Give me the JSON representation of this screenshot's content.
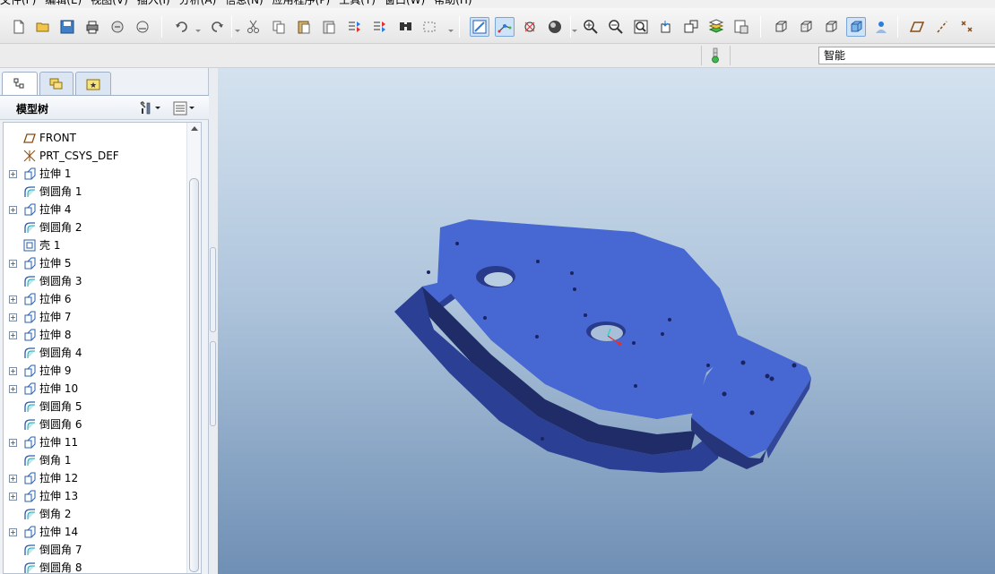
{
  "menubar": {
    "items": [
      "文件(F)",
      "编辑(E)",
      "视图(V)",
      "插入(I)",
      "分析(A)",
      "信息(N)",
      "应用程序(P)",
      "工具(T)",
      "窗口(W)",
      "帮助(H)"
    ]
  },
  "toolbar": {
    "icons": [
      "new-file-icon",
      "open-folder-icon",
      "save-icon",
      "print-icon",
      "send-mail-icon",
      "email-attach-icon",
      "undo-icon",
      "redo-icon",
      "cut-icon",
      "copy-icon",
      "paste-icon",
      "paste-special-icon",
      "regenerate-icon",
      "regenerate-manager-icon",
      "find-icon",
      "select-box-icon",
      "repaint-icon",
      "spin-center-icon",
      "orient-mode-icon",
      "shading-icon",
      "zoom-in-icon",
      "zoom-out-icon",
      "refit-icon",
      "reorient-icon",
      "saved-views-icon",
      "layers-icon",
      "view-manager-icon",
      "wireframe-icon",
      "hidden-line-icon",
      "no-hidden-icon",
      "shaded-icon",
      "enhanced-realism-icon",
      "datum-planes-icon",
      "datum-axes-icon",
      "datum-points-icon"
    ]
  },
  "strip": {
    "filter_value": "智能"
  },
  "model_tree": {
    "title": "模型树",
    "tabs": [
      "model-tree-tab",
      "layer-tab",
      "favorites-tab"
    ],
    "items": [
      {
        "label": "FRONT",
        "type": "datum-plane",
        "expandable": false
      },
      {
        "label": "PRT_CSYS_DEF",
        "type": "csys",
        "expandable": false
      },
      {
        "label": "拉伸 1",
        "type": "extrude",
        "expandable": true
      },
      {
        "label": "倒圆角 1",
        "type": "round",
        "expandable": false
      },
      {
        "label": "拉伸 4",
        "type": "extrude",
        "expandable": true
      },
      {
        "label": "倒圆角 2",
        "type": "round",
        "expandable": false
      },
      {
        "label": "壳 1",
        "type": "shell",
        "expandable": false
      },
      {
        "label": "拉伸 5",
        "type": "extrude",
        "expandable": true
      },
      {
        "label": "倒圆角 3",
        "type": "round",
        "expandable": false
      },
      {
        "label": "拉伸 6",
        "type": "extrude",
        "expandable": true
      },
      {
        "label": "拉伸 7",
        "type": "extrude",
        "expandable": true
      },
      {
        "label": "拉伸 8",
        "type": "extrude",
        "expandable": true
      },
      {
        "label": "倒圆角 4",
        "type": "round",
        "expandable": false
      },
      {
        "label": "拉伸 9",
        "type": "extrude",
        "expandable": true
      },
      {
        "label": "拉伸 10",
        "type": "extrude",
        "expandable": true
      },
      {
        "label": "倒圆角 5",
        "type": "round",
        "expandable": false
      },
      {
        "label": "倒圆角 6",
        "type": "round",
        "expandable": false
      },
      {
        "label": "拉伸 11",
        "type": "extrude",
        "expandable": true
      },
      {
        "label": "倒角 1",
        "type": "round",
        "expandable": false
      },
      {
        "label": "拉伸 12",
        "type": "extrude",
        "expandable": true
      },
      {
        "label": "拉伸 13",
        "type": "extrude",
        "expandable": true
      },
      {
        "label": "倒角 2",
        "type": "round",
        "expandable": false
      },
      {
        "label": "拉伸 14",
        "type": "extrude",
        "expandable": true
      },
      {
        "label": "倒圆角 7",
        "type": "round",
        "expandable": false
      },
      {
        "label": "倒圆角 8",
        "type": "round",
        "expandable": false
      }
    ]
  },
  "colors": {
    "model_blue": "#4a6cd4",
    "model_dark": "#26357a",
    "viewport_top": "#d4e2ef",
    "viewport_bottom": "#6f8fb4"
  }
}
